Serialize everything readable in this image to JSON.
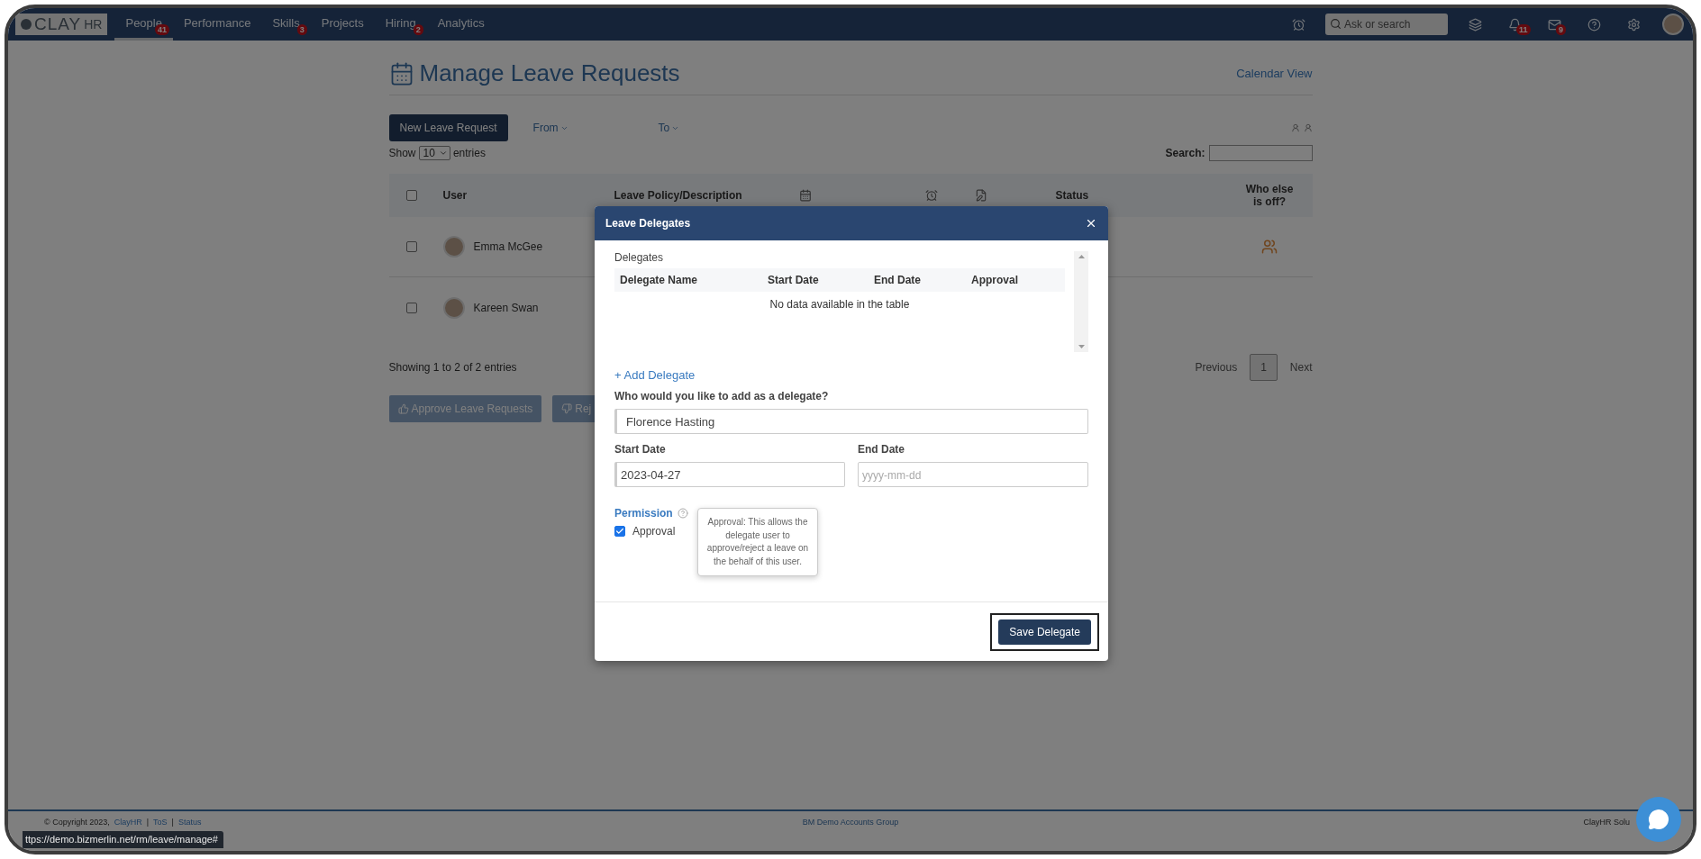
{
  "nav": {
    "logo": {
      "main": "CLAY",
      "suffix": "HR"
    },
    "items": [
      {
        "label": "People",
        "badge": "41",
        "selected": true
      },
      {
        "label": "Performance",
        "selected": false
      },
      {
        "label": "Skills",
        "badge": "3",
        "selected": false
      },
      {
        "label": "Projects",
        "selected": false
      },
      {
        "label": "Hiring",
        "badge": "2",
        "selected": false
      },
      {
        "label": "Analytics",
        "selected": false
      }
    ],
    "tools": [
      {
        "kind": "alarm"
      },
      {
        "kind": "search",
        "placeholder": "Ask or search"
      },
      {
        "kind": "layers"
      },
      {
        "kind": "bell",
        "badge": "11"
      },
      {
        "kind": "mail",
        "badge": "9"
      },
      {
        "kind": "help"
      },
      {
        "kind": "settings"
      },
      {
        "kind": "avatar"
      }
    ]
  },
  "page": {
    "title": "Manage Leave Requests",
    "calendar_link": "Calendar View",
    "new_request": "New Leave Request",
    "filters": [
      "From",
      "To"
    ],
    "show_label": "Show",
    "page_size": "10",
    "entries_label": "entries",
    "search_label": "Search:",
    "columns": [
      {
        "kind": "checkbox",
        "checked": false
      },
      {
        "kind": "text",
        "label": "User"
      },
      {
        "kind": "text",
        "label": "Leave Policy/Description"
      },
      {
        "kind": "calendar"
      },
      {
        "kind": "clock"
      },
      {
        "kind": "note"
      },
      {
        "kind": "text",
        "label": "Status"
      },
      {
        "kind": "text",
        "label": "Who else is off?"
      }
    ],
    "rows": [
      {
        "name": "Emma McGee",
        "checked": false,
        "others_off": true
      },
      {
        "name": "Kareen Swan",
        "checked": false,
        "others_off": false
      }
    ],
    "info": "Showing 1 to 2 of 2 entries",
    "pagination": [
      {
        "label": "Previous",
        "selected": false
      },
      {
        "label": "1",
        "selected": true
      },
      {
        "label": "Next",
        "selected": false
      }
    ],
    "actions": [
      {
        "kind": "approve",
        "label": "Approve Leave Requests"
      },
      {
        "kind": "reject",
        "label": "Rej"
      }
    ]
  },
  "modal": {
    "title": "Leave Delegates",
    "section": "Delegates",
    "columns": [
      "Delegate Name",
      "Start Date",
      "End Date",
      "Approval"
    ],
    "empty": "No data available in the table",
    "add_link": "+ Add Delegate",
    "question": "Who would you like to add as a delegate?",
    "delegate": "Florence Hasting",
    "start_label": "Start Date",
    "start_value": "2023-04-27",
    "end_label": "End Date",
    "end_placeholder": "yyyy-mm-dd",
    "permission": "Permission",
    "approval": {
      "label": "Approval",
      "checked": true
    },
    "tooltip": "Approval: This allows the delegate user to approve/reject a leave on the behalf of this user.",
    "save": "Save Delegate"
  },
  "footer": {
    "left": [
      {
        "kind": "text",
        "text": "© Copyright 2023,"
      },
      {
        "kind": "link",
        "text": "ClayHR"
      },
      {
        "kind": "sep",
        "text": "|"
      },
      {
        "kind": "link",
        "text": "ToS"
      },
      {
        "kind": "sep",
        "text": "|"
      },
      {
        "kind": "link",
        "text": "Status"
      }
    ],
    "center": "BM Demo Accounts Group",
    "right": "ClayHR Solu"
  },
  "status_url": "ttps://demo.bizmerlin.net/rm/leave/manage#"
}
